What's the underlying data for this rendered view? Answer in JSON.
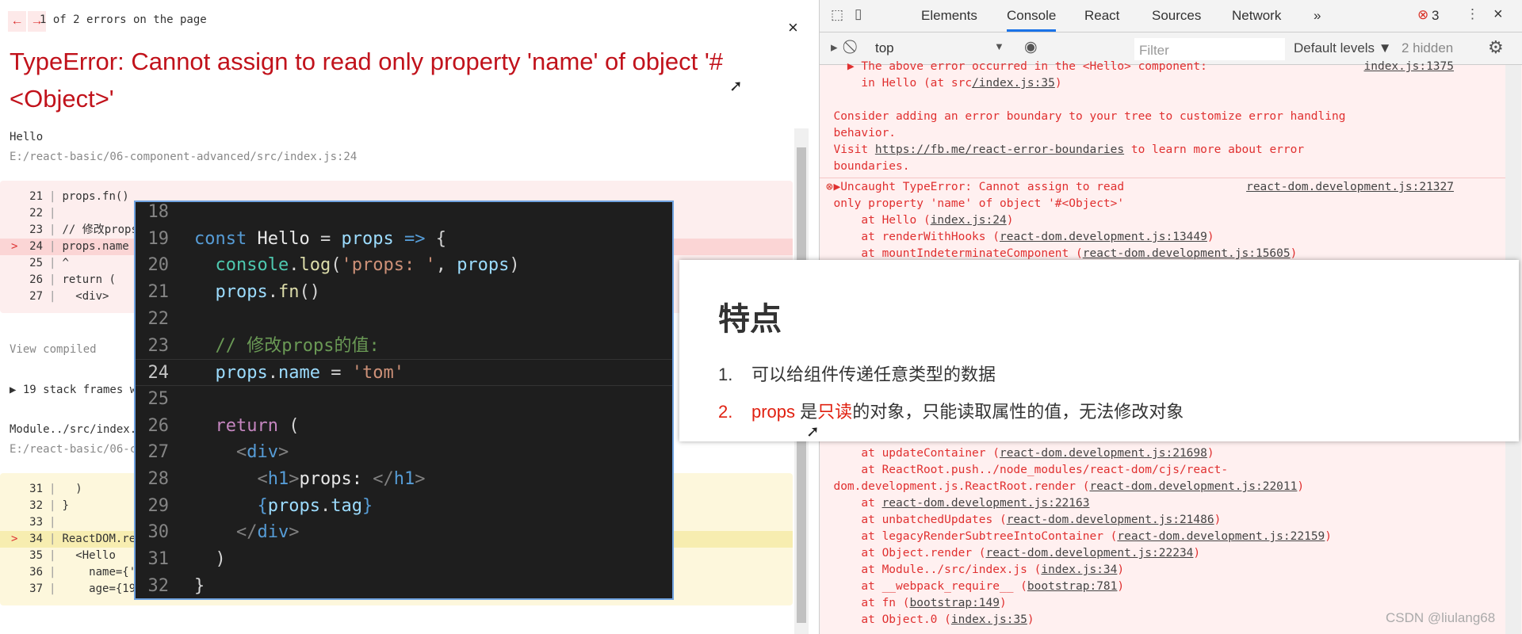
{
  "overlay": {
    "prev": "←",
    "next": "→",
    "error_count": "1 of 2 errors on the page",
    "close": "×",
    "title": "TypeError: Cannot assign to read only property 'name' of object '#<Object>'",
    "frame1": {
      "name": "Hello",
      "path": "E:/react-basic/06-component-advanced/src/index.js:24",
      "lines": [
        {
          "n": "21",
          "t": "props.fn()"
        },
        {
          "n": "22",
          "t": ""
        },
        {
          "n": "23",
          "t": "// 修改props的值:"
        },
        {
          "n": "24",
          "t": "props.name = 'tom'",
          "hl": true
        },
        {
          "n": "25",
          "t": "^"
        },
        {
          "n": "26",
          "t": "return ("
        },
        {
          "n": "27",
          "t": "  <div>"
        }
      ]
    },
    "view_compiled": "View compiled",
    "stack_frames": "▶ 19 stack frames were collapsed.",
    "frame2": {
      "name": "Module../src/index.js",
      "path": "E:/react-basic/06-component-advanced/src/index.js:34",
      "lines": [
        {
          "n": "31",
          "t": "  )"
        },
        {
          "n": "32",
          "t": "}"
        },
        {
          "n": "33",
          "t": ""
        },
        {
          "n": "34",
          "t": "ReactDOM.render(",
          "hl": true
        },
        {
          "n": "35",
          "t": "  <Hello"
        },
        {
          "n": "36",
          "t": "    name={'jack'}"
        },
        {
          "n": "37",
          "t": "    age={19}"
        }
      ]
    }
  },
  "editor": {
    "lines": [
      {
        "n": "18",
        "seg": []
      },
      {
        "n": "19",
        "seg": [
          [
            "k",
            "const "
          ],
          [
            "w",
            "Hello"
          ],
          [
            "p",
            " = "
          ],
          [
            "v",
            "props"
          ],
          [
            "k",
            " => "
          ],
          [
            "p",
            "{"
          ]
        ]
      },
      {
        "n": "20",
        "seg": [
          [
            "p",
            "  "
          ],
          [
            "c",
            "console"
          ],
          [
            "p",
            "."
          ],
          [
            "f",
            "log"
          ],
          [
            "p",
            "("
          ],
          [
            "s",
            "'props: '"
          ],
          [
            "p",
            ", "
          ],
          [
            "v",
            "props"
          ],
          [
            "p",
            ")"
          ]
        ]
      },
      {
        "n": "21",
        "seg": [
          [
            "p",
            "  "
          ],
          [
            "v",
            "props"
          ],
          [
            "p",
            "."
          ],
          [
            "f",
            "fn"
          ],
          [
            "p",
            "()"
          ]
        ]
      },
      {
        "n": "22",
        "seg": []
      },
      {
        "n": "23",
        "seg": [
          [
            "p",
            "  "
          ],
          [
            "cm",
            "// 修改props的值:"
          ]
        ]
      },
      {
        "n": "24",
        "seg": [
          [
            "p",
            "  "
          ],
          [
            "v",
            "props"
          ],
          [
            "p",
            "."
          ],
          [
            "v",
            "name"
          ],
          [
            "p",
            " = "
          ],
          [
            "s",
            "'tom'"
          ]
        ],
        "current": true
      },
      {
        "n": "25",
        "seg": []
      },
      {
        "n": "26",
        "seg": [
          [
            "p",
            "  "
          ],
          [
            "r",
            "return"
          ],
          [
            "p",
            " ("
          ]
        ]
      },
      {
        "n": "27",
        "seg": [
          [
            "p",
            "    "
          ],
          [
            "g",
            "<"
          ],
          [
            "k",
            "div"
          ],
          [
            "g",
            ">"
          ]
        ]
      },
      {
        "n": "28",
        "seg": [
          [
            "p",
            "      "
          ],
          [
            "g",
            "<"
          ],
          [
            "k",
            "h1"
          ],
          [
            "g",
            ">"
          ],
          [
            "w",
            "props: "
          ],
          [
            "g",
            "</"
          ],
          [
            "k",
            "h1"
          ],
          [
            "g",
            ">"
          ]
        ]
      },
      {
        "n": "29",
        "seg": [
          [
            "p",
            "      "
          ],
          [
            "k",
            "{"
          ],
          [
            "v",
            "props"
          ],
          [
            "p",
            "."
          ],
          [
            "v",
            "tag"
          ],
          [
            "k",
            "}"
          ]
        ]
      },
      {
        "n": "30",
        "seg": [
          [
            "p",
            "    "
          ],
          [
            "g",
            "</"
          ],
          [
            "k",
            "div"
          ],
          [
            "g",
            ">"
          ]
        ]
      },
      {
        "n": "31",
        "seg": [
          [
            "p",
            "  )"
          ]
        ]
      },
      {
        "n": "32",
        "seg": [
          [
            "p",
            "}"
          ]
        ]
      }
    ]
  },
  "devtools": {
    "tabs": [
      "Elements",
      "Console",
      "React",
      "Sources",
      "Network"
    ],
    "more_tabs": "»",
    "error_badge": "3",
    "close": "×",
    "context": "top",
    "filter_placeholder": "Filter",
    "levels": "Default levels ▼",
    "hidden": "2 hidden",
    "console_top": [
      {
        "t": "    ▶ The above error occurred in the <Hello> component:",
        "src": "index.js:1375"
      },
      {
        "t": "      in Hello (at src",
        "u": "/index.js:35",
        "e": ")"
      },
      {
        "t": ""
      },
      {
        "t": "  Consider adding an error boundary to your tree to customize error handling"
      },
      {
        "t": "  behavior."
      },
      {
        "t": "  Visit ",
        "u": "https://fb.me/react-error-boundaries",
        "e": " to learn more about error"
      },
      {
        "t": "  boundaries."
      }
    ],
    "error_entry": [
      {
        "t": "  ▶Uncaught TypeError: Cannot assign to read",
        "src": "react-dom.development.js:21327",
        "icon": true
      },
      {
        "t": "  only property 'name' of object '#<Object>'"
      },
      {
        "t": "      at Hello (",
        "u": "index.js:24",
        "e": ")"
      },
      {
        "t": "      at renderWithHooks (",
        "u": "react-dom.development.js:13449",
        "e": ")"
      },
      {
        "t": "      at mountIndeterminateComponent (",
        "u": "react-dom.development.js:15605",
        "e": ")"
      }
    ],
    "console_bottom": [
      {
        "t": "      at updateContainer (",
        "u": "react-dom.development.js:21698",
        "e": ")"
      },
      {
        "t": "      at ReactRoot.push../node_modules/react-dom/cjs/react-"
      },
      {
        "t": "  dom.development.js.ReactRoot.render (",
        "u": "react-dom.development.js:22011",
        "e": ")"
      },
      {
        "t": "      at ",
        "u": "react-dom.development.js:22163"
      },
      {
        "t": "      at unbatchedUpdates (",
        "u": "react-dom.development.js:21486",
        "e": ")"
      },
      {
        "t": "      at legacyRenderSubtreeIntoContainer (",
        "u": "react-dom.development.js:22159",
        "e": ")"
      },
      {
        "t": "      at Object.render (",
        "u": "react-dom.development.js:22234",
        "e": ")"
      },
      {
        "t": "      at Module../src/index.js (",
        "u": "index.js:34",
        "e": ")"
      },
      {
        "t": "      at __webpack_require__ (",
        "u": "bootstrap:781",
        "e": ")"
      },
      {
        "t": "      at fn (",
        "u": "bootstrap:149",
        "e": ")"
      },
      {
        "t": "      at Object.0 (",
        "u": "index.js:35",
        "e": ")"
      }
    ]
  },
  "slide": {
    "title": "特点",
    "items": [
      {
        "n": "1.",
        "text": "可以给组件传递任意类型的数据"
      },
      {
        "n": "2.",
        "pre": "props",
        "mid": " 是",
        "em": "只读",
        "rest": "的对象，只能读取属性的值，无法修改对象"
      }
    ],
    "accent": "#e02010"
  },
  "watermark": "CSDN @liulang68"
}
